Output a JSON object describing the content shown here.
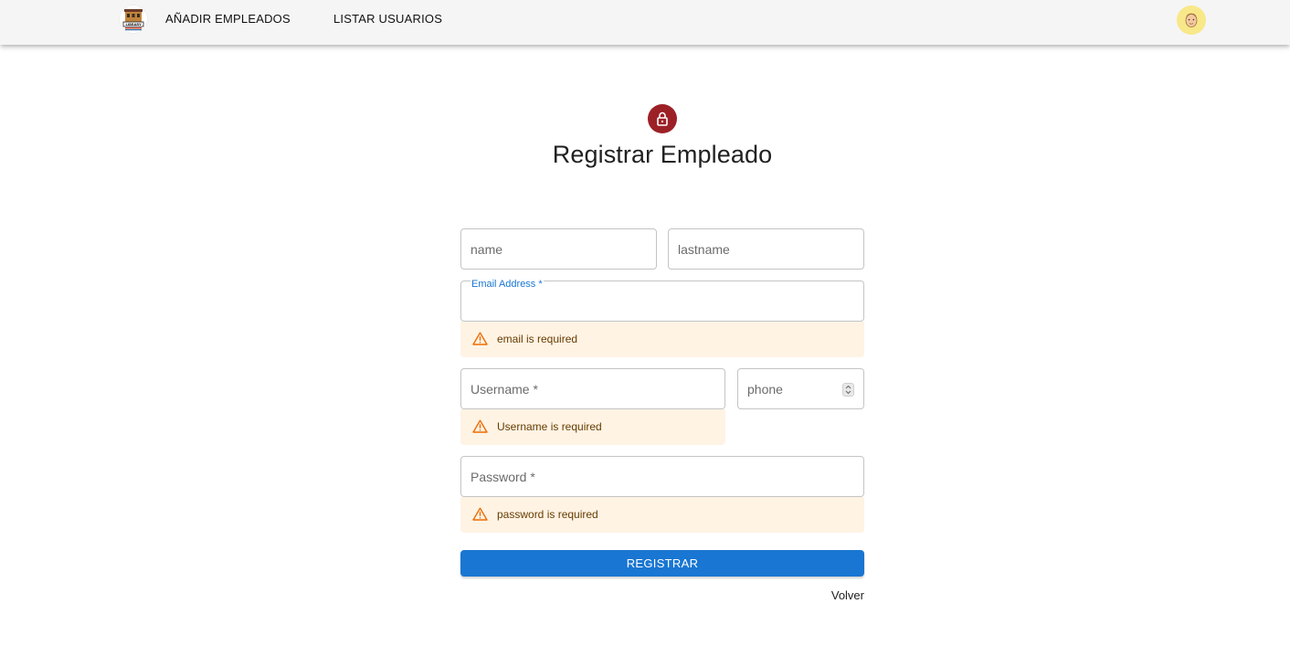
{
  "appbar": {
    "nav": [
      {
        "label": "AÑADIR EMPLEADOS"
      },
      {
        "label": "LISTAR USUARIOS"
      }
    ],
    "logo_icon": "library-logo-icon",
    "avatar_icon": "user-avatar-icon"
  },
  "form": {
    "lock_icon": "lock-icon",
    "accent_color": "#9c2127",
    "title": "Registrar Empleado",
    "fields": {
      "name": {
        "placeholder": "name",
        "value": ""
      },
      "lastname": {
        "placeholder": "lastname",
        "value": ""
      },
      "email": {
        "label": "Email Address *",
        "value": ""
      },
      "username": {
        "placeholder": "Username *",
        "value": ""
      },
      "phone": {
        "placeholder": "phone",
        "value": ""
      },
      "password": {
        "placeholder": "Password *",
        "value": ""
      }
    },
    "errors": {
      "email": "email is required",
      "username": "Username is required",
      "password": "password is required"
    },
    "warning_icon": "warning-icon",
    "submit_label": "REGISTRAR",
    "submit_color": "#1976d2",
    "back_label": "Volver"
  }
}
